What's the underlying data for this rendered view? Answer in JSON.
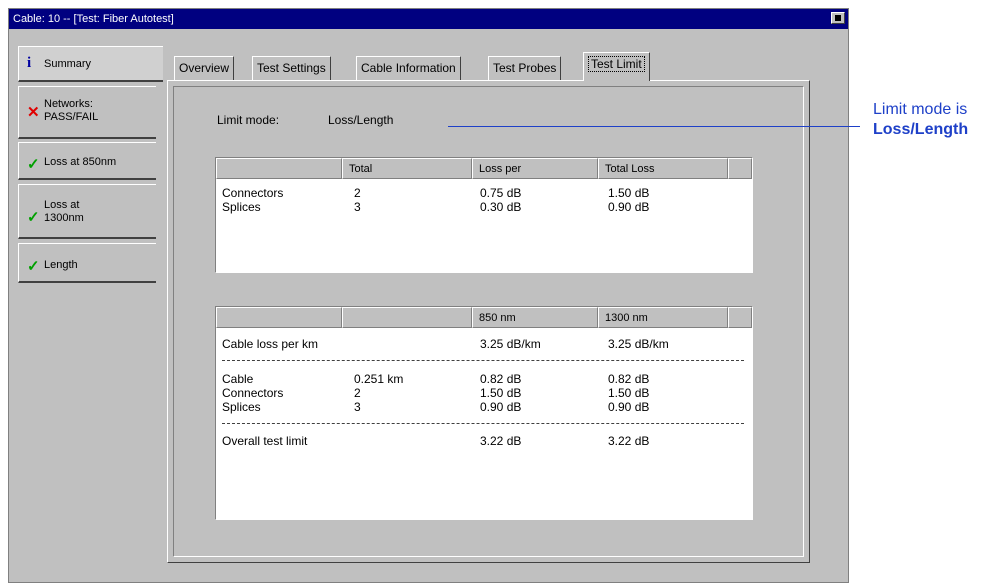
{
  "window": {
    "title": "Cable: 10 -- [Test: Fiber Autotest]"
  },
  "side_tabs": [
    {
      "label": "Summary",
      "icon": "info-icon",
      "status": "info"
    },
    {
      "label_line1": "Networks:",
      "label_line2": "PASS/FAIL",
      "icon": "cross-icon",
      "status": "fail"
    },
    {
      "label": "Loss at 850nm",
      "icon": "check-icon",
      "status": "pass"
    },
    {
      "label_line1": "Loss at",
      "label_line2": "1300nm",
      "icon": "check-icon",
      "status": "pass"
    },
    {
      "label": "Length",
      "icon": "check-icon",
      "status": "pass"
    }
  ],
  "tabs": [
    {
      "label": "Overview"
    },
    {
      "label": "Test Settings"
    },
    {
      "label": "Cable Information"
    },
    {
      "label": "Test Probes"
    },
    {
      "label": "Test Limit",
      "active": true
    }
  ],
  "limit_mode": {
    "label": "Limit mode:",
    "value": "Loss/Length"
  },
  "table1": {
    "headers": [
      "",
      "Total",
      "Loss per",
      "Total Loss"
    ],
    "rows": [
      {
        "name": "Connectors",
        "total": "2",
        "loss_per": "0.75 dB",
        "total_loss": "1.50 dB"
      },
      {
        "name": "Splices",
        "total": "3",
        "loss_per": "0.30 dB",
        "total_loss": "0.90 dB"
      }
    ]
  },
  "table2": {
    "headers": [
      "",
      "",
      "850 nm",
      "1300 nm"
    ],
    "cable_loss": {
      "name": "Cable loss per km",
      "nm850": "3.25 dB/km",
      "nm1300": "3.25 dB/km"
    },
    "rows": [
      {
        "name": "Cable",
        "value": "0.251 km",
        "nm850": "0.82 dB",
        "nm1300": "0.82 dB"
      },
      {
        "name": "Connectors",
        "value": "2",
        "nm850": "1.50 dB",
        "nm1300": "1.50 dB"
      },
      {
        "name": "Splices",
        "value": "3",
        "nm850": "0.90 dB",
        "nm1300": "0.90 dB"
      }
    ],
    "overall": {
      "name": "Overall test limit",
      "nm850": "3.22 dB",
      "nm1300": "3.22 dB"
    }
  },
  "callout": {
    "line1": "Limit mode is",
    "line2": "Loss/Length",
    "color": "#1e40c8"
  },
  "colors": {
    "titlebar": "#000080",
    "fail": "#e00000",
    "pass": "#00a000",
    "info": "#0000a0"
  }
}
